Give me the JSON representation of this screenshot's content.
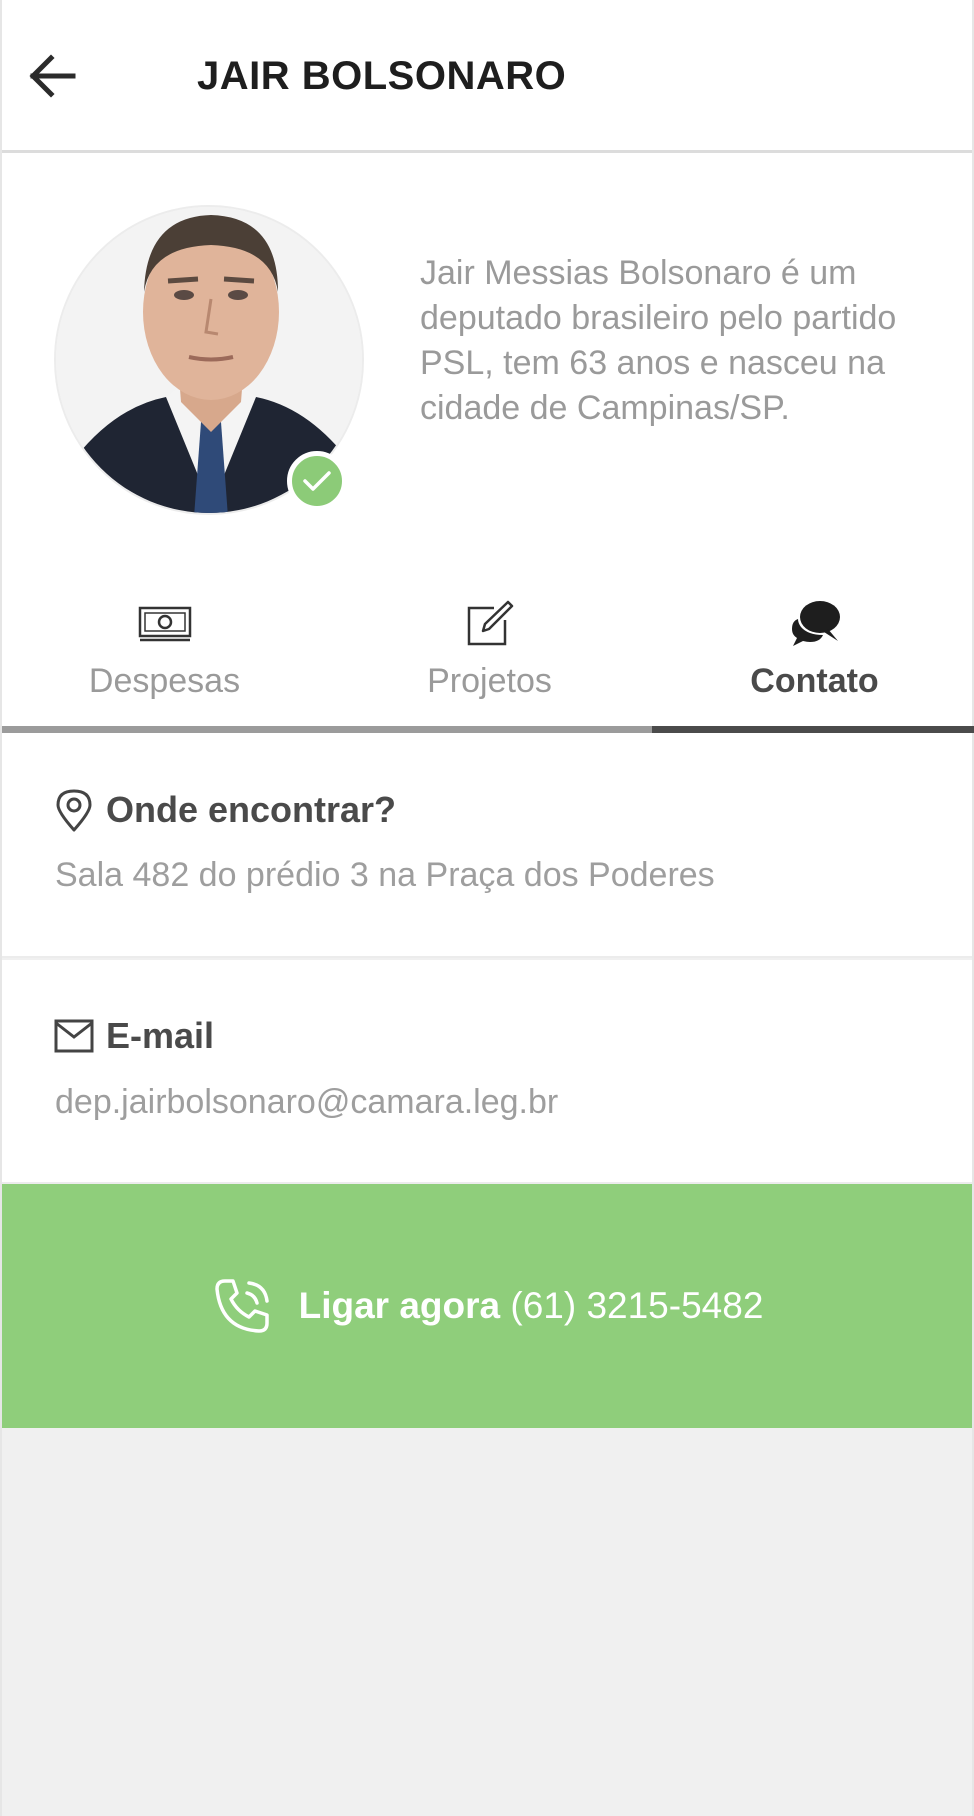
{
  "header": {
    "title": "JAIR BOLSONARO",
    "back_icon": "arrow-left-icon"
  },
  "profile": {
    "bio": "Jair Messias Bolsonaro é um deputado brasileiro pelo partido PSL, tem 63 anos e nasceu na cidade de Campinas/SP.",
    "verified_icon": "check-icon",
    "verified_color": "#8ccb78"
  },
  "tabs": [
    {
      "label": "Despesas",
      "icon": "money-icon",
      "active": false
    },
    {
      "label": "Projetos",
      "icon": "edit-icon",
      "active": false
    },
    {
      "label": "Contato",
      "icon": "chat-bubbles-icon",
      "active": true
    }
  ],
  "contact": {
    "location": {
      "title": "Onde encontrar?",
      "value": "Sala 482 do prédio 3 na Praça dos Poderes",
      "icon": "location-pin-icon"
    },
    "email": {
      "title": "E-mail",
      "value": "dep.jairbolsonaro@camara.leg.br",
      "icon": "mail-icon"
    }
  },
  "call": {
    "label": "Ligar agora",
    "phone": "(61) 3215-5482",
    "icon": "phone-icon",
    "color": "#8fce7b"
  }
}
